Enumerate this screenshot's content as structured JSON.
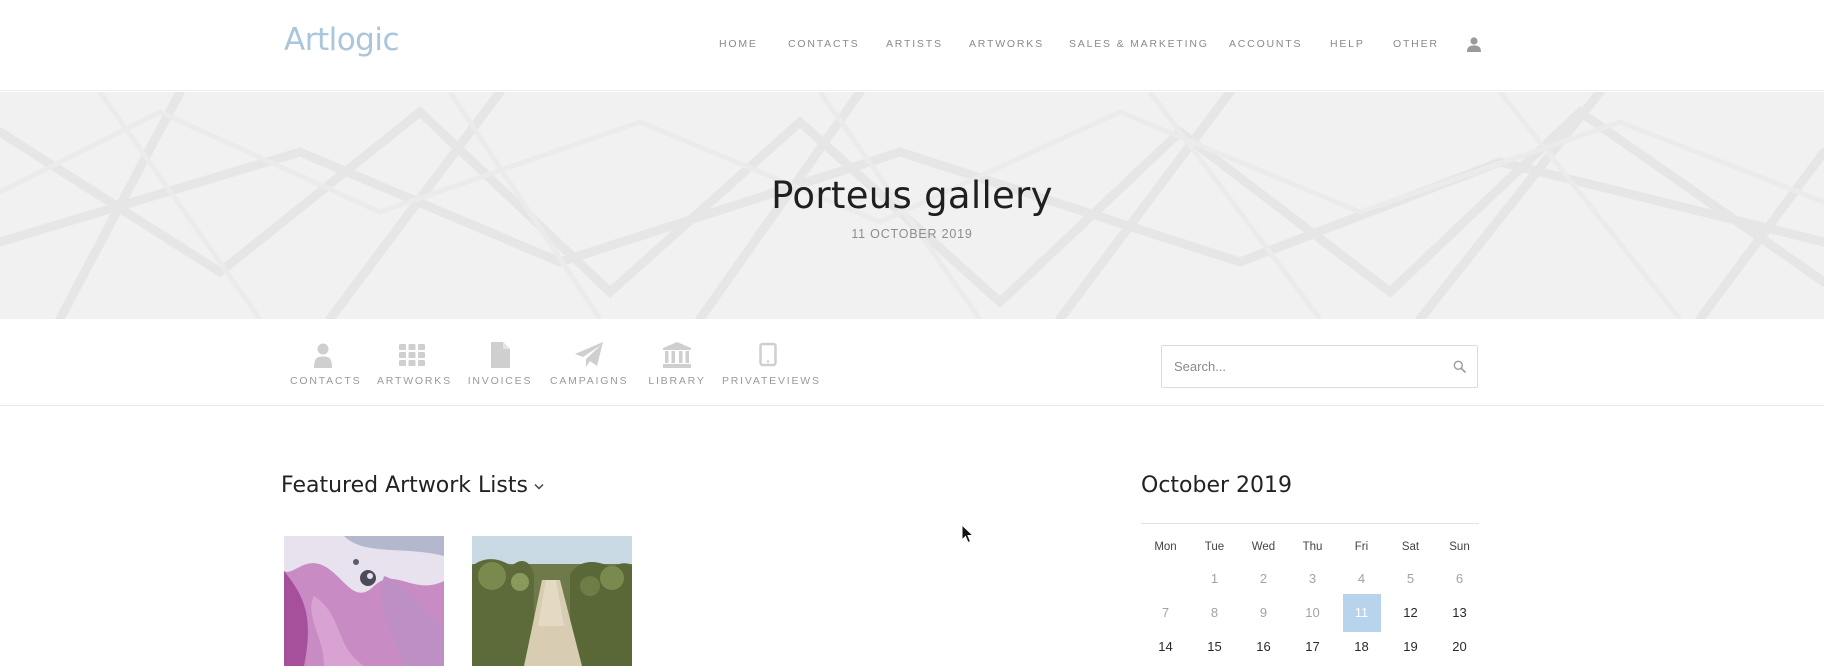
{
  "header": {
    "logo": "Artlogic",
    "nav": [
      "HOME",
      "CONTACTS",
      "ARTISTS",
      "ARTWORKS",
      "SALES & MARKETING",
      "ACCOUNTS",
      "HELP",
      "OTHER"
    ]
  },
  "hero": {
    "title": "Porteus gallery",
    "date": "11 OCTOBER 2019"
  },
  "quicklinks": [
    "CONTACTS",
    "ARTWORKS",
    "INVOICES",
    "CAMPAIGNS",
    "LIBRARY",
    "PRIVATEVIEWS"
  ],
  "search": {
    "placeholder": "Search..."
  },
  "featured": {
    "title": "Featured Artwork Lists"
  },
  "calendar": {
    "title": "October 2019",
    "weekdays": [
      "Mon",
      "Tue",
      "Wed",
      "Thu",
      "Fri",
      "Sat",
      "Sun"
    ],
    "rows": [
      [
        "",
        "1",
        "2",
        "3",
        "4",
        "5",
        "6"
      ],
      [
        "7",
        "8",
        "9",
        "10",
        "11",
        "12",
        "13"
      ],
      [
        "14",
        "15",
        "16",
        "17",
        "18",
        "19",
        "20"
      ]
    ],
    "today": "11"
  },
  "colors": {
    "logo": "#a9c6dc",
    "today_highlight": "#b8d3ec",
    "hero_bg": "#f1f1f1"
  },
  "icons": {
    "user": "user-icon",
    "search": "search-icon",
    "quicklinks": [
      "person-icon",
      "grid-icon",
      "document-icon",
      "paper-plane-icon",
      "bank-icon",
      "tablet-icon"
    ]
  }
}
